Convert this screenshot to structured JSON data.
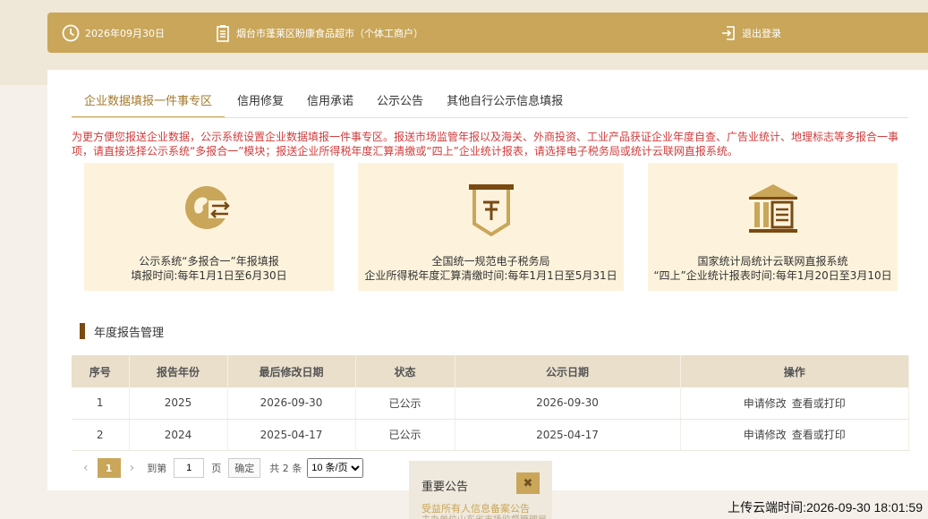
{
  "topbar": {
    "date": "2026年09月30日",
    "company": "烟台市蓬莱区盼康食品超市（个体工商户）",
    "logout": "退出登录"
  },
  "tabs": [
    {
      "label": "企业数据填报一件事专区",
      "active": true
    },
    {
      "label": "信用修复",
      "active": false
    },
    {
      "label": "信用承诺",
      "active": false
    },
    {
      "label": "公示公告",
      "active": false
    },
    {
      "label": "其他自行公示信息填报",
      "active": false
    }
  ],
  "notice": "为更方便您报送企业数据，公示系统设置企业数据填报一件事专区。报送市场监管年报以及海关、外商投资、工业产品获证企业年度自查、广告业统计、地理标志等多报合一事项，请直接选择公示系统“多报合一”模块；报送企业所得税年度汇算清缴或“四上”企业统计报表，请选择电子税务局或统计云联网直报系统。",
  "services": [
    {
      "icon": "exchange-icon",
      "line1": "公示系统“多报合一”年报填报",
      "line2": "填报时间:每年1月1日至6月30日"
    },
    {
      "icon": "tax-icon",
      "line1": "全国统一规范电子税务局",
      "line2": "企业所得税年度汇算清缴时间:每年1月1日至5月31日"
    },
    {
      "icon": "government-building-icon",
      "line1": "国家统计局统计云联网直报系统",
      "line2": "“四上”企业统计报表时间:每年1月20日至3月10日"
    }
  ],
  "section_title": "年度报告管理",
  "table": {
    "headers": [
      "序号",
      "报告年份",
      "最后修改日期",
      "状态",
      "公示日期",
      "操作"
    ],
    "rows": [
      {
        "no": "1",
        "year": "2025",
        "modified": "2026-09-30",
        "status": "已公示",
        "published": "2026-09-30",
        "op1": "申请修改",
        "op2": "查看或打印"
      },
      {
        "no": "2",
        "year": "2024",
        "modified": "2025-04-17",
        "status": "已公示",
        "published": "2025-04-17",
        "op1": "申请修改",
        "op2": "查看或打印"
      }
    ]
  },
  "pager": {
    "prev": "‹",
    "current": "1",
    "next": "›",
    "goto_label": "到第",
    "goto_value": "1",
    "page_unit": "页",
    "confirm": "确定",
    "total": "共 2 条",
    "page_size": "10 条/页"
  },
  "popup": {
    "title": "重要公告",
    "close": "✖",
    "line1": "受益所有人信息备案公告",
    "line2": "主办单位山东省市场监督管理局"
  },
  "upload_time": "上传云端时间:2026-09-30 18:01:59",
  "colors": {
    "gold": "#c9a659",
    "brown": "#7a4a12",
    "red": "#d23b3b",
    "card_bg": "#fdf3dc"
  }
}
